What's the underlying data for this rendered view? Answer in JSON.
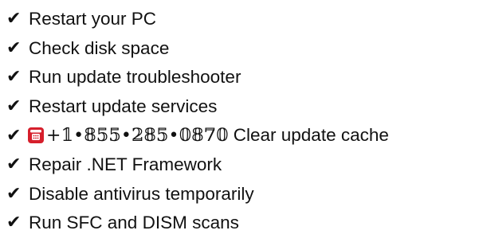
{
  "checklist": {
    "items": [
      {
        "label": "Restart your PC"
      },
      {
        "label": "Check disk space"
      },
      {
        "label": "Run update troubleshooter"
      },
      {
        "label": "Restart update services"
      },
      {
        "phone": "+𝟙•𝟠𝟝𝟝•𝟚𝟠𝟝•𝟘𝟠𝟟𝟘",
        "label": "Clear update cache"
      },
      {
        "label": "Repair .NET Framework"
      },
      {
        "label": "Disable antivirus temporarily"
      },
      {
        "label": "Run SFC and DISM scans"
      }
    ],
    "check_mark": "✔",
    "phone_icon": "telephone-icon"
  },
  "colors": {
    "text": "#111111",
    "phone_icon": "#d61f2c"
  }
}
